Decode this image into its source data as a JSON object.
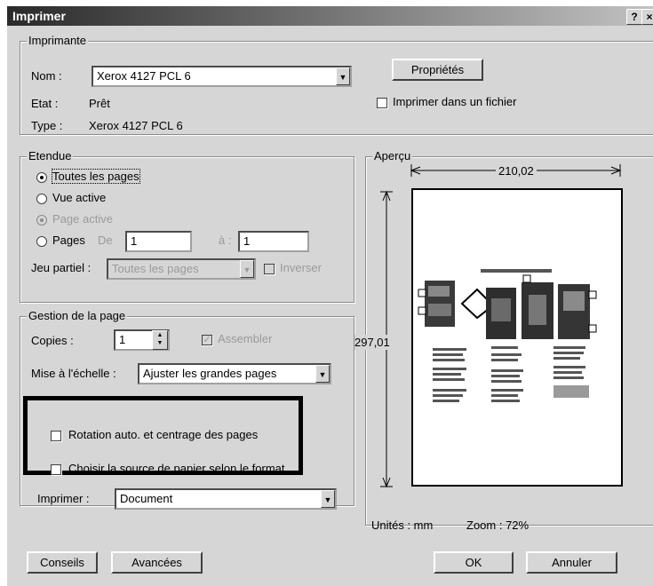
{
  "window": {
    "title": "Imprimer",
    "help_label": "?",
    "close_label": "×"
  },
  "printer": {
    "group_label": "Imprimante",
    "name_label": "Nom :",
    "name_value": "Xerox 4127 PCL 6",
    "state_label": "Etat :",
    "state_value": "Prêt",
    "type_label": "Type :",
    "type_value": "Xerox 4127 PCL 6",
    "properties_button": "Propriétés",
    "print_to_file_label": "Imprimer dans un fichier"
  },
  "range": {
    "group_label": "Etendue",
    "all_pages": "Toutes les pages",
    "current_view": "Vue active",
    "active_page": "Page active",
    "pages_label": "Pages",
    "from_label": "De",
    "from_value": "1",
    "to_label": "à :",
    "to_value": "1",
    "subset_label": "Jeu partiel :",
    "subset_value": "Toutes les pages",
    "reverse_label": "Inverser"
  },
  "handling": {
    "group_label": "Gestion de la page",
    "copies_label": "Copies :",
    "copies_value": "1",
    "collate_label": "Assembler",
    "scaling_label": "Mise à l'échelle :",
    "scaling_value": "Ajuster les grandes pages",
    "auto_rotate_label": "Rotation auto. et centrage des pages",
    "paper_source_label": "Choisir la source de papier selon le format"
  },
  "print_what": {
    "label": "Imprimer :",
    "value": "Document"
  },
  "preview": {
    "group_label": "Aperçu",
    "width_value": "210,02",
    "height_value": "297,01",
    "units_label": "Unités : mm",
    "zoom_label": "Zoom : 72%"
  },
  "buttons": {
    "tips": "Conseils",
    "advanced": "Avancées",
    "ok": "OK",
    "cancel": "Annuler"
  }
}
